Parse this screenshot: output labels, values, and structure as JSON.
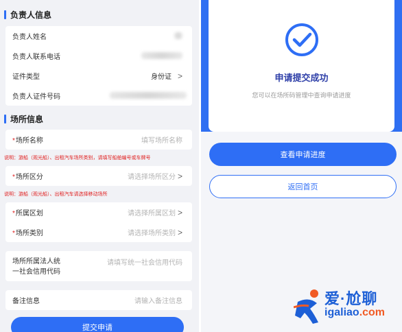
{
  "form": {
    "section_responsible": "负责人信息",
    "section_venue": "场所信息",
    "responsible_rows": [
      {
        "label": "负责人姓名",
        "value": ""
      },
      {
        "label": "负责人联系电话",
        "value": ""
      },
      {
        "label": "证件类型",
        "value": "身份证"
      },
      {
        "label": "负责人证件号码",
        "value": ""
      }
    ],
    "venue_name": {
      "required": "*",
      "label": "场所名称",
      "placeholder": "填写场所名称"
    },
    "note1": "说明：游船（观光船）、出租汽车场所类别，请填写船舶编号或车牌号",
    "venue_zone": {
      "required": "*",
      "label": "场所区分",
      "placeholder": "请选择场所区分"
    },
    "note2": "说明：游船（观光船）、出租汽车请选择移动场所",
    "district": {
      "required": "*",
      "label": "所属区划",
      "placeholder": "请选择所属区划"
    },
    "category": {
      "required": "*",
      "label": "场所类别",
      "placeholder": "请选择场所类别"
    },
    "credit_code": {
      "label_line1": "场所所属法人统",
      "label_line2": "一社会信用代码",
      "placeholder": "请填写统一社会信用代码"
    },
    "remark": {
      "label": "备注信息",
      "placeholder": "请输入备注信息"
    },
    "chevron": ">",
    "submit_label": "提交申请"
  },
  "result": {
    "title": "申请提交成功",
    "subtitle": "您可以在场所码管理中查询申请进度",
    "view_progress_label": "查看申请进度",
    "home_label": "返回首页"
  },
  "watermark": {
    "text": "爱·尬聊",
    "url_part1": "igaliao",
    "url_part2": ".com"
  },
  "colors": {
    "accent": "#2e6ef5",
    "required": "#e02020",
    "title": "#2e3fa8",
    "watermark_blue": "#1d5fd6",
    "watermark_orange": "#f15a24"
  }
}
